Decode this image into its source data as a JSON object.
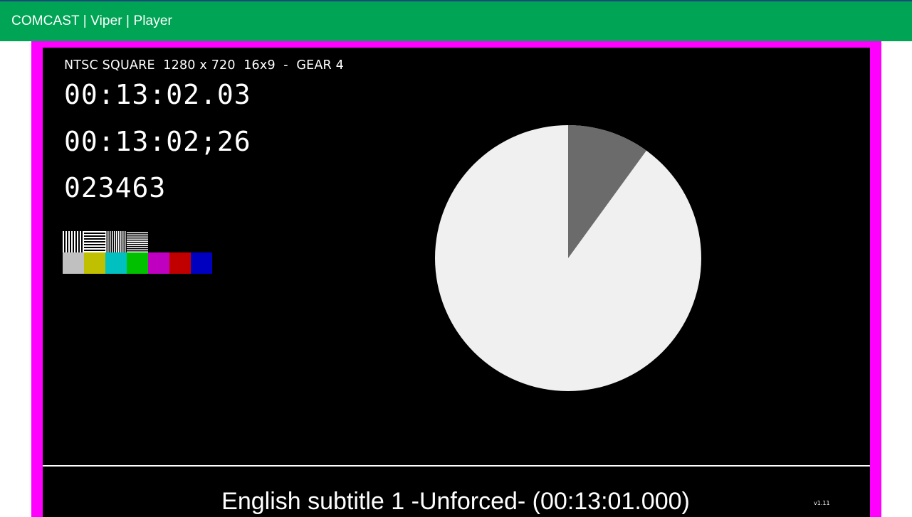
{
  "app": {
    "title": "COMCAST | Viper | Player",
    "bar_color": "#00a455"
  },
  "player": {
    "frame_color": "#ff00ff",
    "info_line": "NTSC SQUARE  1280 x 720  16x9  -  GEAR 4",
    "timecode_decimal": "00:13:02.03",
    "timecode_dropframe": "00:13:02;26",
    "frame_count": "023463",
    "test_pattern": {
      "grates": [
        "vertical-fine",
        "horizontal-fine",
        "vertical-finer",
        "horizontal-finer"
      ],
      "color_bars": [
        "#c0c0c0",
        "#c0c000",
        "#00c0c0",
        "#00c000",
        "#c000c0",
        "#c00000",
        "#0000c0"
      ]
    },
    "progress_pie": {
      "filled_fraction": 0.1,
      "filled_color": "#6b6b6b",
      "remaining_color": "#f0f0f0"
    },
    "version": "v1.11",
    "subtitle": "English subtitle 1 -Unforced- (00:13:01.000)"
  }
}
